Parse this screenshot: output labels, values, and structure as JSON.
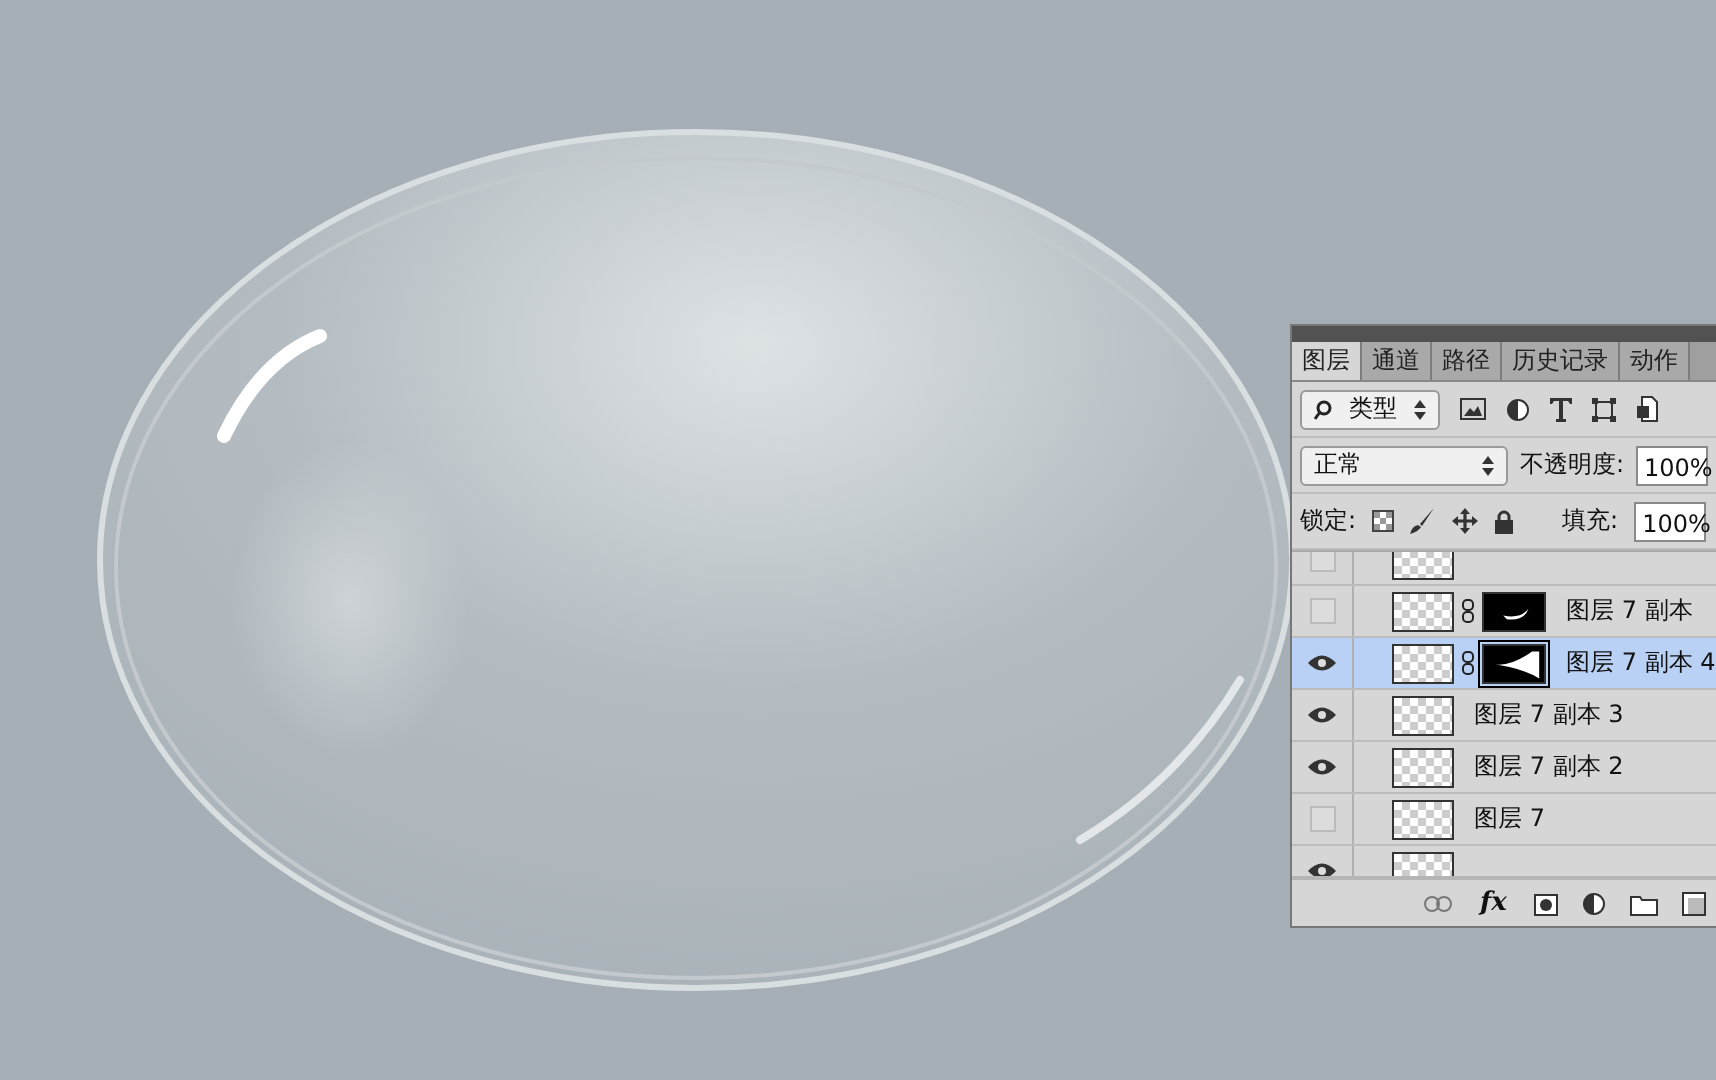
{
  "panel": {
    "tabs": [
      {
        "label": "图层",
        "selected": true
      },
      {
        "label": "通道",
        "selected": false
      },
      {
        "label": "路径",
        "selected": false
      },
      {
        "label": "历史记录",
        "selected": false
      },
      {
        "label": "动作",
        "selected": false
      }
    ],
    "filter": {
      "value": "类型"
    },
    "blend_mode": {
      "value": "正常"
    },
    "opacity": {
      "label": "不透明度:",
      "value": "100%"
    },
    "lock": {
      "label": "锁定:"
    },
    "fill": {
      "label": "填充:",
      "value": "100%"
    },
    "layers": [
      {
        "visible": false,
        "selected": false,
        "kind": "plain"
      },
      {
        "name": "图层 7 副本",
        "visible": false,
        "selected": false,
        "kind": "masked"
      },
      {
        "name": "图层 7 副本 4",
        "visible": true,
        "selected": true,
        "kind": "masked"
      },
      {
        "name": "图层 7 副本 3",
        "visible": true,
        "selected": false,
        "kind": "plain"
      },
      {
        "name": "图层 7 副本 2",
        "visible": true,
        "selected": false,
        "kind": "plain"
      },
      {
        "name": "图层 7",
        "visible": false,
        "selected": false,
        "kind": "plain"
      },
      {
        "visible": true,
        "selected": false,
        "kind": "plain"
      }
    ],
    "footer": {
      "fx_label": "fx"
    }
  }
}
